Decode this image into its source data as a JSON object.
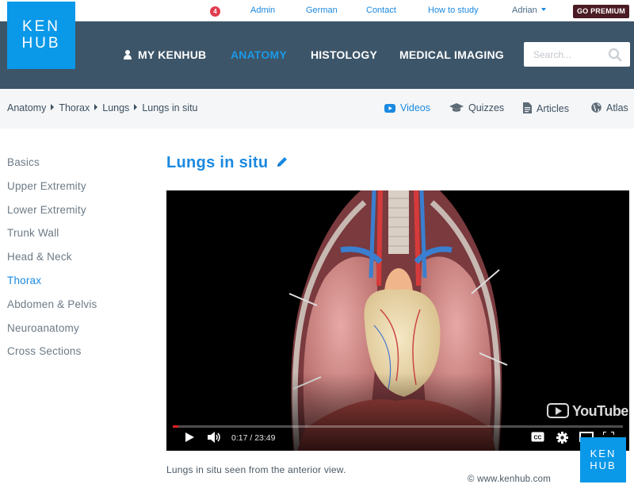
{
  "header": {
    "logo": {
      "line1": "KEN",
      "line2": "HUB"
    },
    "notification_count": "4",
    "top_links": [
      "Admin",
      "German",
      "Contact",
      "How to study"
    ],
    "user_name": "Adrian",
    "premium_label": "GO PREMIUM",
    "nav": [
      {
        "label": "MY KENHUB",
        "icon": "user-icon"
      },
      {
        "label": "ANATOMY",
        "active": true
      },
      {
        "label": "HISTOLOGY"
      },
      {
        "label": "MEDICAL IMAGING"
      }
    ],
    "search_placeholder": "Search..."
  },
  "breadcrumb": [
    "Anatomy",
    "Thorax",
    "Lungs",
    "Lungs in situ"
  ],
  "media_tabs": [
    {
      "label": "Videos",
      "icon": "youtube-icon",
      "active": true
    },
    {
      "label": "Quizzes",
      "icon": "graduation-cap-icon"
    },
    {
      "label": "Articles",
      "icon": "document-icon"
    },
    {
      "label": "Atlas",
      "icon": "globe-icon"
    }
  ],
  "sidebar": {
    "items": [
      {
        "label": "Basics"
      },
      {
        "label": "Upper Extremity"
      },
      {
        "label": "Lower Extremity"
      },
      {
        "label": "Trunk Wall"
      },
      {
        "label": "Head & Neck"
      },
      {
        "label": "Thorax",
        "active": true
      },
      {
        "label": "Abdomen & Pelvis"
      },
      {
        "label": "Neuroanatomy"
      },
      {
        "label": "Cross Sections"
      }
    ]
  },
  "main": {
    "title": "Lungs in situ",
    "video": {
      "current_time": "0:17",
      "duration": "23:49",
      "time_display": "0:17 / 23:49",
      "progress_fraction": 0.012,
      "watermark": "YouTube"
    },
    "caption": "Lungs in situ seen from the anterior view.",
    "copyright": "© www.kenhub.com"
  },
  "colors": {
    "accent": "#1a89e0",
    "navbar": "#3d5568",
    "logo": "#0a98e8",
    "premium": "#4b1b24",
    "notification": "#e23c4e"
  }
}
